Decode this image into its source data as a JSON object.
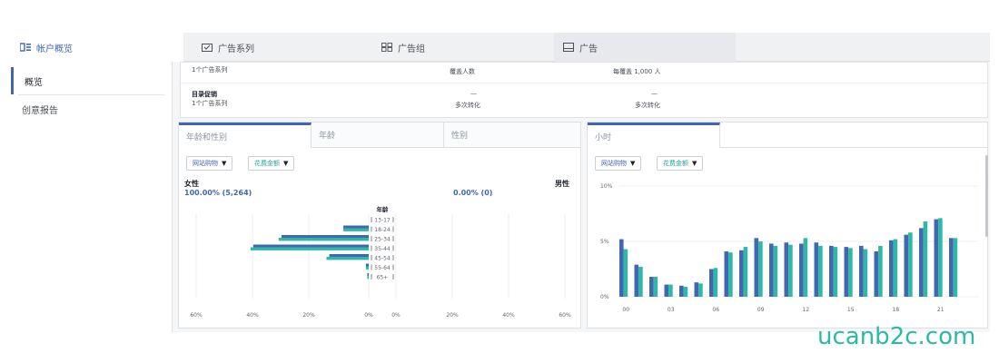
{
  "tabs": [
    {
      "label": "帐户概览",
      "icon": "account-overview-icon"
    },
    {
      "label": "广告系列",
      "icon": "campaign-icon"
    },
    {
      "label": "广告组",
      "icon": "adset-icon"
    },
    {
      "label": "广告",
      "icon": "ad-icon"
    }
  ],
  "sidebar": {
    "items": [
      {
        "label": "概览"
      },
      {
        "label": "创意报告"
      }
    ]
  },
  "summary": {
    "row1": {
      "campaign": "1个广告系列",
      "metric": "覆盖人数",
      "cost": "每覆盖 1,000 人"
    },
    "row2": {
      "name": "目录促销",
      "campaign": "1个广告系列",
      "metric_value": "—",
      "metric": "多次转化",
      "cost_value": "—",
      "cost": "多次转化"
    }
  },
  "left_panel": {
    "tabs": [
      "年龄和性别",
      "年龄",
      "性别"
    ],
    "filters": [
      "网站购物",
      "花费金额"
    ],
    "female_label": "女性",
    "female_value": "100.00% (5,264)",
    "male_label": "男性",
    "male_value": "0.00% (0)"
  },
  "right_panel": {
    "tabs": [
      "小时"
    ],
    "filters": [
      "网站购物",
      "花费金额"
    ]
  },
  "colors": {
    "blue": "#4267b2",
    "teal": "#2fb8a5",
    "accent": "#4267b2"
  },
  "watermark": "ucanb2c.com",
  "chart_data": [
    {
      "type": "bar",
      "orientation": "horizontal",
      "title": "年龄",
      "categories": [
        "13-17",
        "18-24",
        "25-34",
        "35-44",
        "45-54",
        "55-64",
        "65+"
      ],
      "series": [
        {
          "values": [
            0,
            9,
            31,
            41,
            14,
            1,
            0.5
          ]
        },
        {
          "values": [
            0,
            9,
            32,
            42,
            15,
            1,
            0.5
          ]
        }
      ],
      "xticks": [
        "60%",
        "40%",
        "20%",
        "0%",
        "0%",
        "20%",
        "40%",
        "60%"
      ],
      "xlim": [
        0,
        60
      ]
    },
    {
      "type": "bar",
      "x": [
        0,
        1,
        2,
        3,
        4,
        5,
        6,
        7,
        8,
        9,
        10,
        11,
        12,
        13,
        14,
        15,
        16,
        17,
        18,
        19,
        20,
        21,
        22,
        23
      ],
      "xticks": [
        "00",
        "03",
        "06",
        "09",
        "12",
        "15",
        "18",
        "21"
      ],
      "yticks": [
        "10%",
        "5%",
        "0%"
      ],
      "ylim": [
        0,
        10
      ],
      "series": [
        {
          "values": [
            5.2,
            2.9,
            1.8,
            1.1,
            1.0,
            1.3,
            2.5,
            4.1,
            4.2,
            5.3,
            4.8,
            4.9,
            4.8,
            4.9,
            4.6,
            4.5,
            4.6,
            4.1,
            5.1,
            5.6,
            6.2,
            7.0,
            5.3,
            0
          ]
        },
        {
          "values": [
            4.3,
            2.7,
            1.8,
            1.1,
            0.9,
            1.2,
            2.6,
            4.0,
            4.5,
            5.0,
            4.6,
            4.7,
            5.3,
            4.6,
            4.5,
            4.4,
            4.3,
            4.6,
            5.2,
            5.8,
            6.8,
            7.1,
            5.3,
            0
          ]
        }
      ]
    }
  ]
}
